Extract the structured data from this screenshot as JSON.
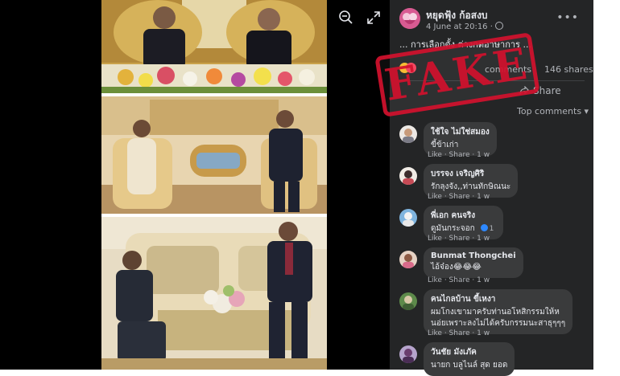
{
  "post": {
    "author": "หยุดฟุ้ง ก้อสงบ",
    "time": "4 June at 20:16 ·",
    "text": "... การเลือกตั้ง ต่างกตอาษาการ ..."
  },
  "stats": {
    "comments": "comments",
    "shares": "146 shares"
  },
  "actions": {
    "share_label": "Share",
    "top_comments": "Top comments ▾"
  },
  "icons": {
    "more": "more-icon",
    "zoom_out": "zoom-out-icon",
    "expand": "expand-icon",
    "share": "share-arrow-icon"
  },
  "comment_actions": {
    "like": "Like",
    "share": "Share"
  },
  "comments": [
    {
      "name": "ใช้ใจ ไม่ใช่สมอง",
      "lines": [
        "ขี้ข้าเก่า"
      ],
      "time": "1 w"
    },
    {
      "name": "บรรจง เจริญศิริ",
      "lines": [
        "รักลุงจัง,,ท่านทักษิณนะ"
      ],
      "time": "1 w"
    },
    {
      "name": "พี่เอก คนจริง",
      "lines": [
        "ดูมันกระจอก"
      ],
      "time": "1 w",
      "badge": "1"
    },
    {
      "name": "Bunmat Thongchei",
      "lines": [
        "ไอ้จ๋อง😂😂😂"
      ],
      "time": "1 w"
    },
    {
      "name": "คนไกลบ้าน ขี้เหงา",
      "lines": [
        "ผมโกงเขามาครับท่านอโหสิกรรมให้ห",
        "นอ่ยเพราะลงไม่ได้ครับกรรมนะสาธุๆๆๆ"
      ],
      "time": "1 w"
    },
    {
      "name": "วันชัย มังเภัค",
      "lines": [
        "นายก บลูไนล์ สุด ยอด"
      ],
      "time": ""
    }
  ],
  "stamp": {
    "text": "FAKE"
  },
  "colors": {
    "panel": "#242526",
    "bubble": "#3a3b3c",
    "stamp": "#d2122e",
    "viewer": "#000000"
  }
}
